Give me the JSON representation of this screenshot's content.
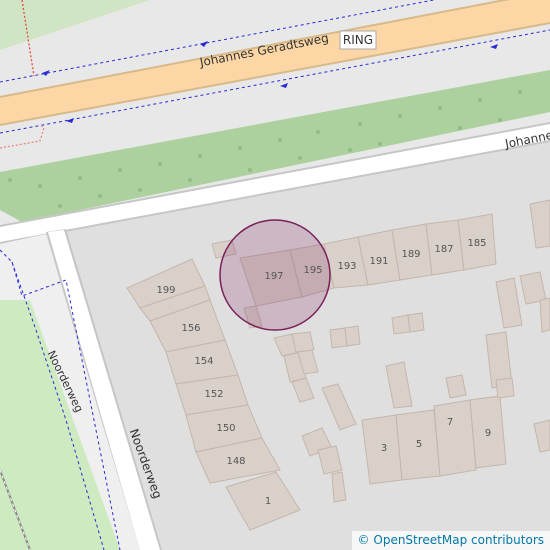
{
  "streets": {
    "main_road": "Johannes Geradtsweg",
    "main_road_ref": "RING",
    "service_road": "Johannes Geradtsweg",
    "service_road_visible": "Johannes",
    "side_road": "Noorderweg",
    "path": "Noorderweg"
  },
  "house_numbers": {
    "n199": "199",
    "n197": "197",
    "n195": "195",
    "n193": "193",
    "n191": "191",
    "n189": "189",
    "n187": "187",
    "n185": "185",
    "n156": "156",
    "n154": "154",
    "n152": "152",
    "n150": "150",
    "n148": "148",
    "n1": "1",
    "n3": "3",
    "n5": "5",
    "n7": "7",
    "n9": "9"
  },
  "attribution": {
    "symbol": "©",
    "text": "OpenStreetMap contributors"
  },
  "colors": {
    "background": "#e0dfdf",
    "residential": "#e0dfdf",
    "building": "#d9d0c9",
    "building_stroke": "#c4b6ab",
    "primary_road": "#fcd6a4",
    "primary_road_casing": "#c99d63",
    "road": "#ffffff",
    "grass": "#aed1a0",
    "park": "#c8facc",
    "cycleway": "#0000ff",
    "footway": "#fa8072",
    "highlight_circle": "#7a1f5c"
  }
}
